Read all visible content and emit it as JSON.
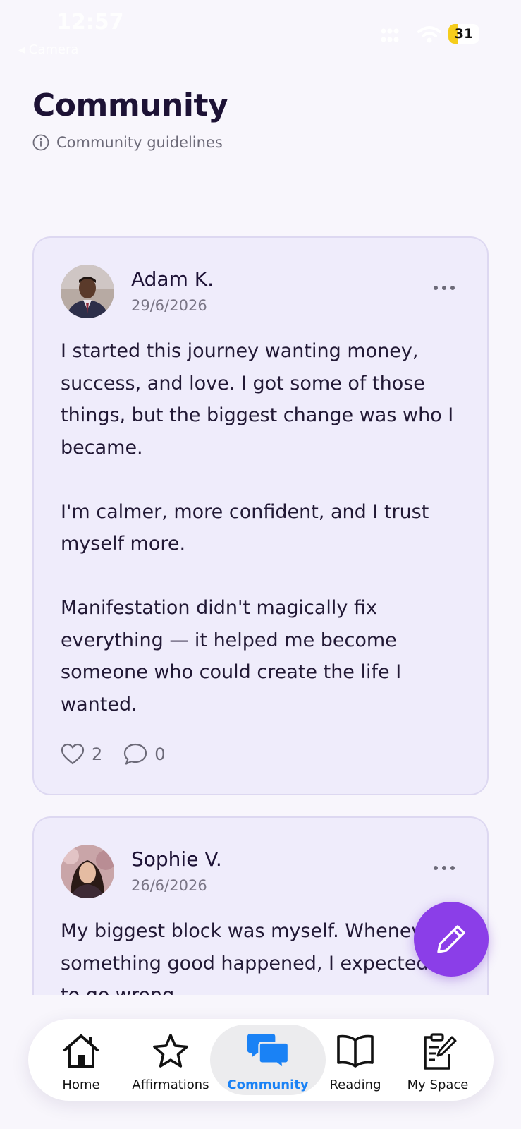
{
  "status_bar": {
    "time": "12:57",
    "back_label": "◂ Camera",
    "battery": "31"
  },
  "header": {
    "title": "Community",
    "guidelines_label": "Community guidelines"
  },
  "posts": [
    {
      "author": "Adam K.",
      "date": "29/6/2026",
      "paragraphs": [
        "I started this journey wanting money, success, and love. I got some of those things, but the biggest change was who I became.",
        "I'm calmer, more confident, and I trust myself more.",
        "Manifestation didn't magically fix everything — it helped me become someone who could create the life I wanted."
      ],
      "likes": "2",
      "comments": "0"
    },
    {
      "author": "Sophie V.",
      "date": "26/6/2026",
      "paragraphs": [
        "My biggest block was myself. Whenever something good happened, I expected it to go wrong."
      ]
    }
  ],
  "tabs": [
    {
      "label": "Home",
      "icon": "home-icon"
    },
    {
      "label": "Affirmations",
      "icon": "star-icon"
    },
    {
      "label": "Community",
      "icon": "chat-bubbles-icon",
      "active": true
    },
    {
      "label": "Reading",
      "icon": "book-icon"
    },
    {
      "label": "My Space",
      "icon": "journal-icon"
    }
  ],
  "colors": {
    "accent": "#8b3ee8",
    "active_tab": "#1a82f5",
    "card_bg": "#efecfb"
  }
}
